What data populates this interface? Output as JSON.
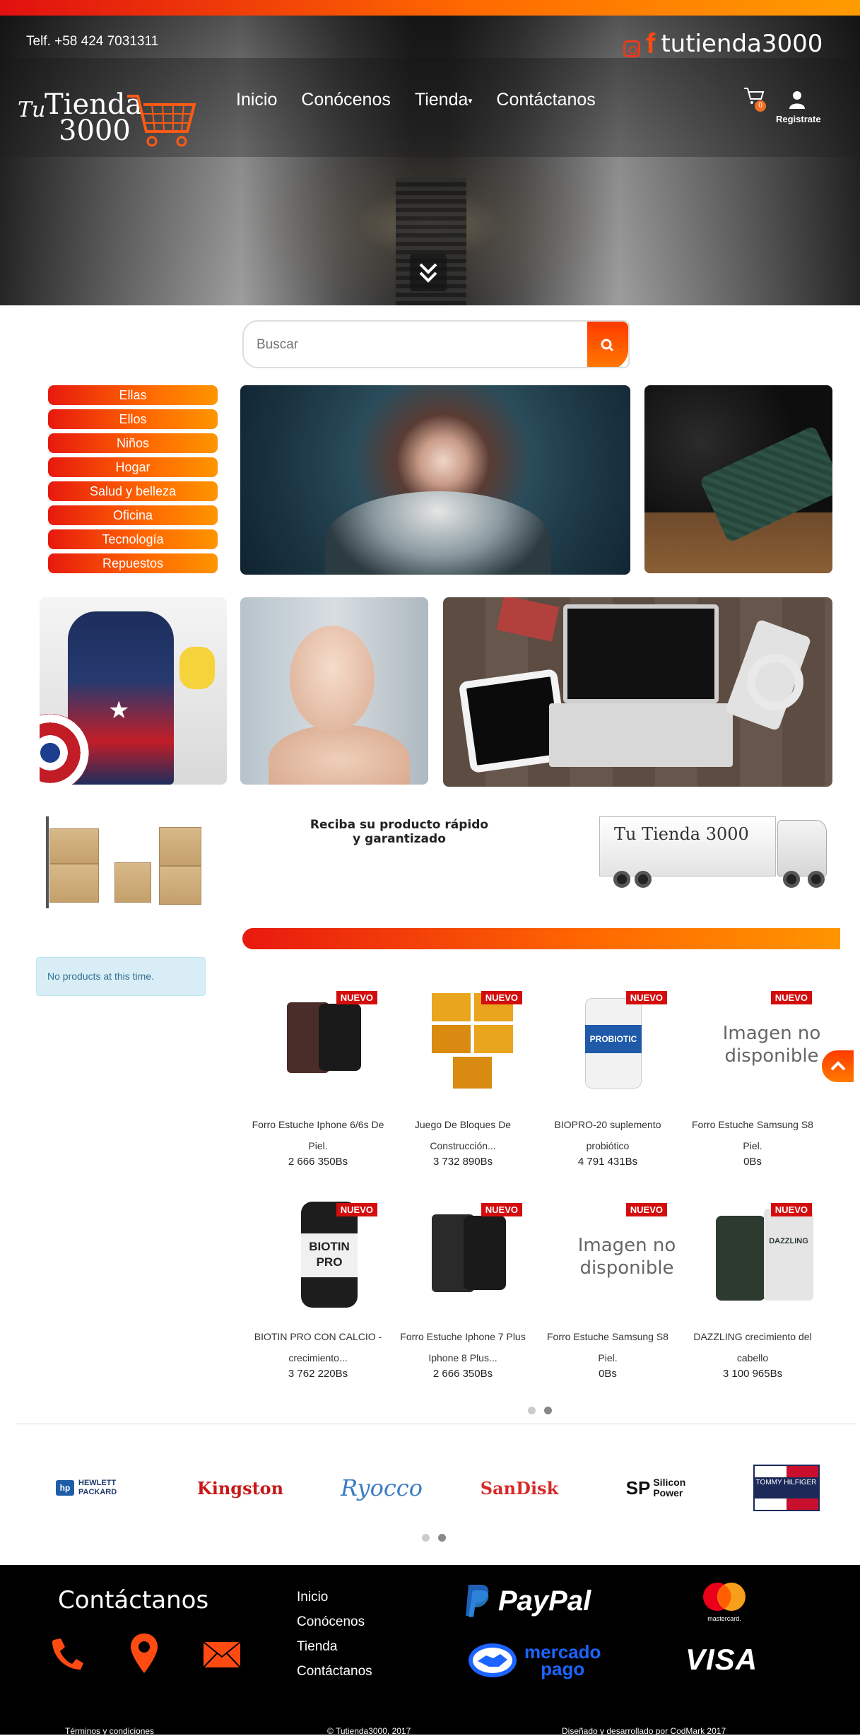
{
  "header": {
    "phone": "Telf. +58 424 7031311",
    "social_handle": "tutienda3000",
    "logo": {
      "tu": "Tu",
      "tienda": "Tienda",
      "number": "3000"
    },
    "nav": [
      "Inicio",
      "Conócenos",
      "Tienda",
      "Contáctanos"
    ],
    "cart_count": "0",
    "register_label": "Registrate",
    "accent_color": "#ff6a00"
  },
  "search": {
    "placeholder": "Buscar"
  },
  "categories": [
    "Ellas",
    "Ellos",
    "Niños",
    "Hogar",
    "Salud y belleza",
    "Oficina",
    "Tecnología",
    "Repuestos"
  ],
  "delivery": {
    "line1": "Reciba su producto rápido",
    "line2": "y garantizado",
    "truck_logo": "Tu Tienda 3000"
  },
  "sidebar_notice": "No products at this time.",
  "badge_label": "NUEVO",
  "no_image_text": "Imagen no disponible",
  "products": [
    {
      "name1": "Forro Estuche Iphone 6/6s De",
      "name2": "Piel.",
      "price": "2 666 350Bs"
    },
    {
      "name1": "Juego De Bloques De",
      "name2": "Construcción...",
      "price": "3 732 890Bs"
    },
    {
      "name1": "BIOPRO-20 suplemento",
      "name2": "probiótico",
      "price": "4 791 431Bs"
    },
    {
      "name1": "Forro Estuche Samsung S8",
      "name2": "Piel.",
      "price": "0Bs"
    },
    {
      "name1": "BIOTIN PRO CON CALCIO -",
      "name2": "crecimiento...",
      "price": "3 762 220Bs"
    },
    {
      "name1": "Forro Estuche Iphone 7 Plus",
      "name2": "Iphone 8 Plus...",
      "price": "2 666 350Bs"
    },
    {
      "name1": "Forro Estuche Samsung S8",
      "name2": "Piel.",
      "price": "0Bs"
    },
    {
      "name1": "DAZZLING crecimiento del",
      "name2": "cabello",
      "price": "3 100 965Bs"
    }
  ],
  "product_labels": {
    "probiotic": "PROBIOTIC",
    "biotin": "BIOTIN",
    "biotin2": "PRO",
    "dazzling": "DAZZLING"
  },
  "brands": [
    "HEWLETT PACKARD",
    "Kingston",
    "Ryocco",
    "SanDisk",
    "Silicon Power",
    "TOMMY HILFIGER"
  ],
  "footer": {
    "title": "Contáctanos",
    "links": [
      "Inicio",
      "Conócenos",
      "Tienda",
      "Contáctanos"
    ],
    "paypal": "PayPal",
    "mastercard": "mastercard.",
    "mercadopago1": "mercado",
    "mercadopago2": "pago",
    "visa": "VISA",
    "bottom": [
      "Términos y condiciones",
      "© Tutienda3000, 2017",
      "Diseñado y desarrollado por CodMark 2017"
    ]
  }
}
